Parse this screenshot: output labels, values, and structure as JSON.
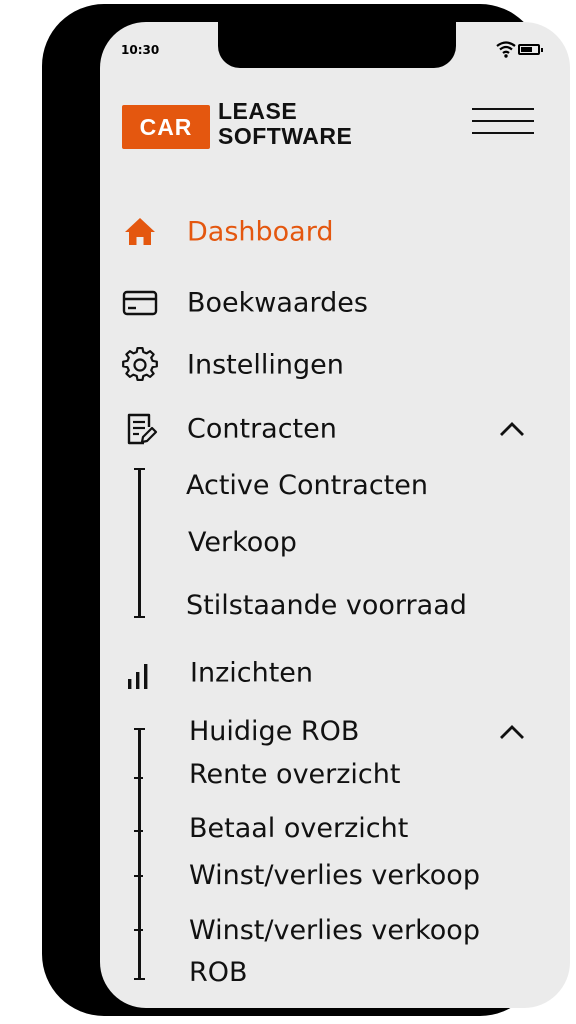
{
  "status_bar": {
    "time": "10:30",
    "wifi_icon": "wifi-icon",
    "battery_icon": "battery-icon"
  },
  "logo": {
    "badge": "CAR",
    "line1": "LEASE",
    "line2": "SOFTWARE"
  },
  "colors": {
    "accent": "#e4570f",
    "text": "#111111",
    "background": "#ebebeb"
  },
  "menu": {
    "dashboard": {
      "label": "Dashboard",
      "icon": "home-icon",
      "active": true
    },
    "boekwaardes": {
      "label": "Boekwaardes",
      "icon": "credit-card-icon"
    },
    "instellingen": {
      "label": "Instellingen",
      "icon": "gear-icon"
    },
    "contracten": {
      "label": "Contracten",
      "icon": "document-edit-icon",
      "expanded": true,
      "items": [
        "Active Contracten",
        "Verkoop",
        "Stilstaande voorraad"
      ]
    },
    "inzichten": {
      "label": "Inzichten",
      "icon": "bar-chart-icon"
    },
    "huidige_rob": {
      "label": "Huidige ROB",
      "expanded": true,
      "items": [
        "Rente overzicht",
        "Betaal overzicht",
        "Winst/verlies verkoop",
        "Winst/verlies verkoop",
        "ROB"
      ]
    }
  }
}
